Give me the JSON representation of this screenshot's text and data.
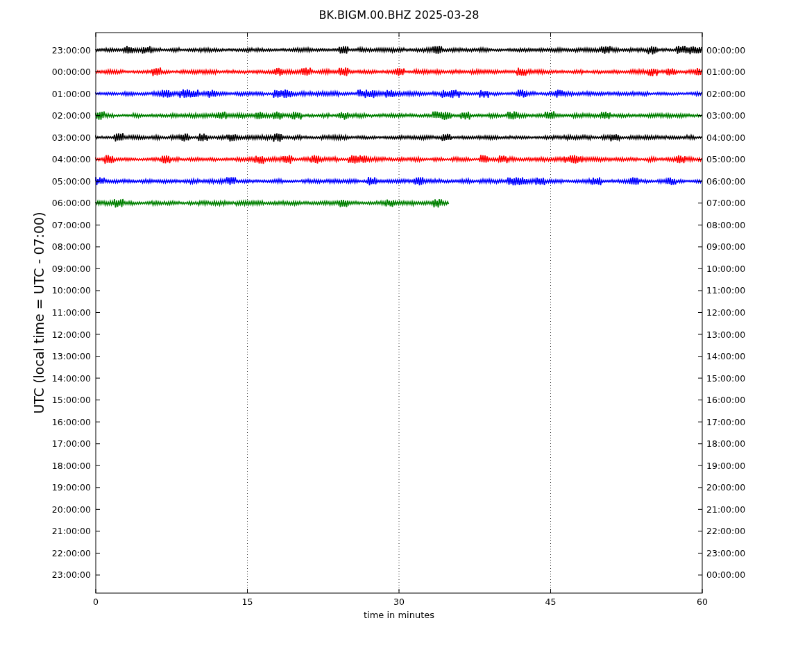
{
  "title": "BK.BIGM.00.BHZ 2025-03-28",
  "ylabel": "UTC (local time = UTC - 07:00)",
  "xlabel": "time in minutes",
  "xticks": [
    "0",
    "15",
    "30",
    "45",
    "60"
  ],
  "left_labels": [
    "23:00:00",
    "00:00:00",
    "01:00:00",
    "02:00:00",
    "03:00:00",
    "04:00:00",
    "05:00:00",
    "06:00:00",
    "07:00:00",
    "08:00:00",
    "09:00:00",
    "10:00:00",
    "11:00:00",
    "12:00:00",
    "13:00:00",
    "14:00:00",
    "15:00:00",
    "16:00:00",
    "17:00:00",
    "18:00:00",
    "19:00:00",
    "20:00:00",
    "21:00:00",
    "22:00:00",
    "23:00:00"
  ],
  "right_labels": [
    "00:00:00",
    "01:00:00",
    "02:00:00",
    "03:00:00",
    "04:00:00",
    "05:00:00",
    "06:00:00",
    "07:00:00",
    "08:00:00",
    "09:00:00",
    "10:00:00",
    "11:00:00",
    "12:00:00",
    "13:00:00",
    "14:00:00",
    "15:00:00",
    "16:00:00",
    "17:00:00",
    "18:00:00",
    "19:00:00",
    "20:00:00",
    "21:00:00",
    "22:00:00",
    "23:00:00",
    "00:00:00"
  ],
  "traces": [
    {
      "color": "#000000",
      "level": 1
    },
    {
      "color": "#ff0000",
      "level": 1
    },
    {
      "color": "#0000ff",
      "level": 1
    },
    {
      "color": "#008000",
      "level": 1
    },
    {
      "color": "#000000",
      "level": 1
    },
    {
      "color": "#ff0000",
      "level": 1
    },
    {
      "color": "#0000ff",
      "level": 1
    },
    {
      "color": "#008000",
      "level": 0.583
    }
  ]
}
